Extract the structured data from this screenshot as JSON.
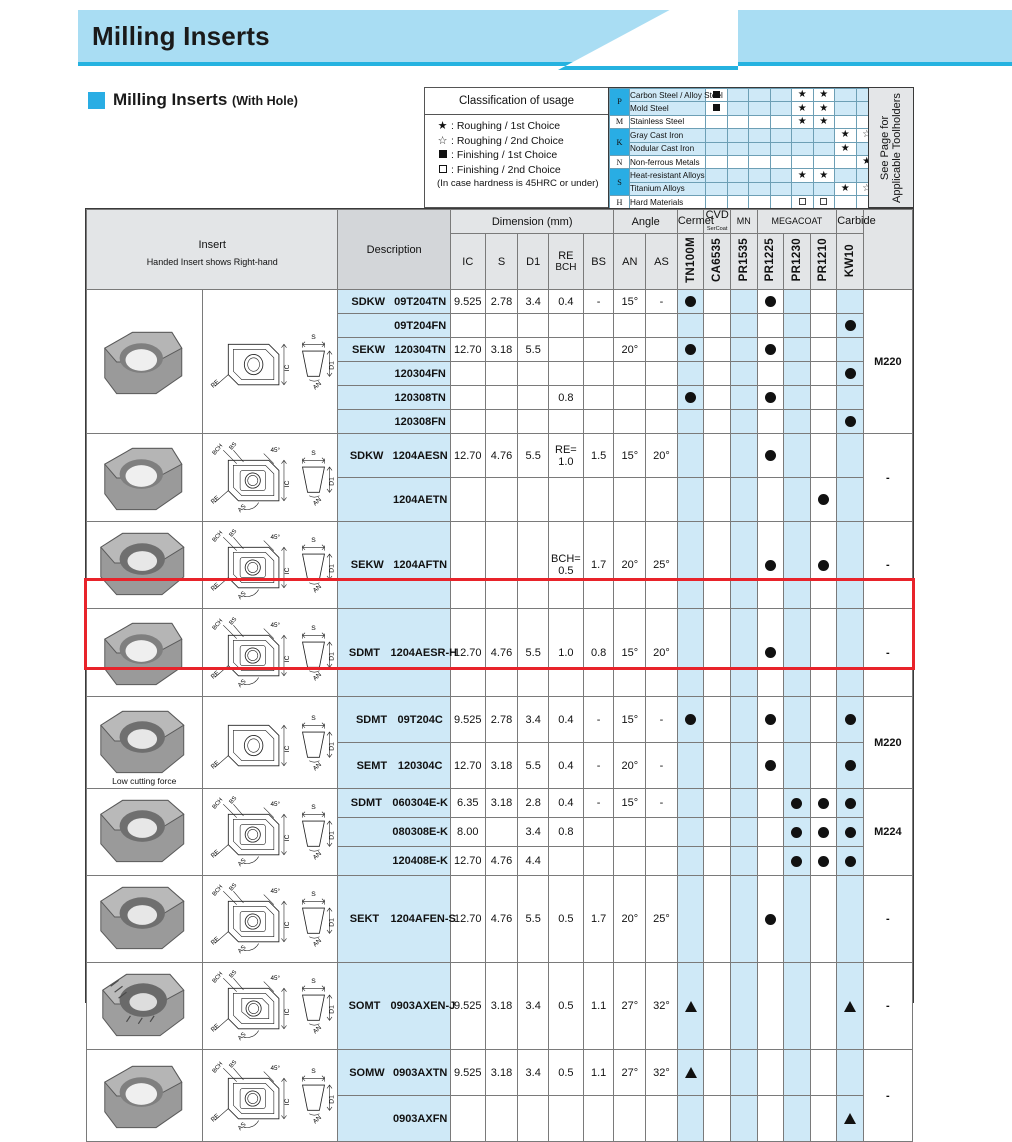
{
  "banner": {
    "title": "Milling Inserts"
  },
  "subtitle": {
    "text": "Milling Inserts",
    "suffix": "(With Hole)"
  },
  "legend": {
    "title": "Classification of usage",
    "rows": [
      {
        "symbol": "star-filled",
        "text": ": Roughing / 1st Choice"
      },
      {
        "symbol": "star-open",
        "text": ": Roughing / 2nd Choice"
      },
      {
        "symbol": "square-filled",
        "text": ": Finishing / 1st Choice"
      },
      {
        "symbol": "square-open",
        "text": ": Finishing / 2nd Choice"
      }
    ],
    "note": "(In case hardness is 45HRC or under)"
  },
  "matrix": {
    "rows": [
      {
        "cat": "P",
        "cat_span": 2,
        "cat_fill": "cyan",
        "name": "Carbon Steel / Alloy Steel",
        "name_fill": "lblue",
        "marks": [
          "square-filled",
          "",
          "",
          "",
          "star-filled",
          "star-filled",
          "",
          ""
        ]
      },
      {
        "cat": "",
        "cat_span": 0,
        "cat_fill": "cyan",
        "name": "Mold Steel",
        "name_fill": "lblue",
        "marks": [
          "square-filled",
          "",
          "",
          "",
          "star-filled",
          "star-filled",
          "",
          ""
        ]
      },
      {
        "cat": "M",
        "cat_span": 1,
        "cat_fill": "wh",
        "name": "Stainless Steel",
        "name_fill": "wh",
        "marks": [
          "",
          "",
          "",
          "",
          "star-filled",
          "star-filled",
          "",
          ""
        ]
      },
      {
        "cat": "K",
        "cat_span": 2,
        "cat_fill": "cyan",
        "name": "Gray Cast Iron",
        "name_fill": "lblue",
        "marks": [
          "",
          "",
          "",
          "",
          "",
          "",
          "star-filled",
          "star-open"
        ]
      },
      {
        "cat": "",
        "cat_span": 0,
        "cat_fill": "cyan",
        "name": "Nodular Cast Iron",
        "name_fill": "lblue",
        "marks": [
          "",
          "",
          "",
          "",
          "",
          "",
          "star-filled",
          ""
        ]
      },
      {
        "cat": "N",
        "cat_span": 1,
        "cat_fill": "wh",
        "name": "Non-ferrous Metals",
        "name_fill": "wh",
        "marks": [
          "",
          "",
          "",
          "",
          "",
          "",
          "",
          "star-filled"
        ]
      },
      {
        "cat": "S",
        "cat_span": 2,
        "cat_fill": "cyan",
        "name": "Heat-resistant Alloys",
        "name_fill": "lblue",
        "marks": [
          "",
          "",
          "",
          "",
          "star-filled",
          "star-filled",
          "",
          ""
        ]
      },
      {
        "cat": "",
        "cat_span": 0,
        "cat_fill": "cyan",
        "name": "Titanium Alloys",
        "name_fill": "lblue",
        "marks": [
          "",
          "",
          "",
          "",
          "",
          "",
          "star-filled",
          "star-open"
        ]
      },
      {
        "cat": "H",
        "cat_span": 1,
        "cat_fill": "wh",
        "name": "Hard Materials",
        "name_fill": "wh",
        "marks": [
          "",
          "",
          "",
          "",
          "square-open",
          "square-open",
          "",
          ""
        ]
      }
    ]
  },
  "side_column": {
    "line1": "See Page for",
    "line2": "Applicable Toolholders"
  },
  "table_header": {
    "insert": "Insert",
    "insert_note": "Handed Insert shows Right-hand",
    "description": "Description",
    "dimension": "Dimension (mm)",
    "angle": "Angle",
    "dim_cols": [
      "IC",
      "S",
      "D1",
      "RE\nBCH",
      "BS"
    ],
    "angle_cols": [
      "AN",
      "AS"
    ],
    "grade_groups": [
      "Cermet",
      "CVD\nSeriCoat",
      "MN",
      "MEGACOAT",
      "Carbide"
    ],
    "grade_names": [
      "TN100M",
      "CA6535",
      "PR1535",
      "PR1225",
      "PR1230",
      "PR1210",
      "KW10"
    ]
  },
  "blocks": [
    {
      "id": "block-1",
      "caption": "",
      "highlight": false,
      "toolholder": "M220",
      "rows": [
        {
          "prefix": "SDKW",
          "code": "09T204TN",
          "ic": "9.525",
          "s": "2.78",
          "d1": "3.4",
          "re": "0.4",
          "bs": "-",
          "an": "15°",
          "as": "-",
          "grades": [
            "dot",
            "",
            "",
            "dot",
            "",
            "",
            ""
          ]
        },
        {
          "prefix": "",
          "code": "09T204FN",
          "ic": "",
          "s": "",
          "d1": "",
          "re": "",
          "bs": "",
          "an": "",
          "as": "",
          "grades": [
            "",
            "",
            "",
            "",
            "",
            "",
            "dot"
          ]
        },
        {
          "prefix": "SEKW",
          "code": "120304TN",
          "ic": "12.70",
          "s": "3.18",
          "d1": "5.5",
          "re": "",
          "bs": "",
          "an": "20°",
          "as": "",
          "grades": [
            "dot",
            "",
            "",
            "dot",
            "",
            "",
            ""
          ]
        },
        {
          "prefix": "",
          "code": "120304FN",
          "ic": "",
          "s": "",
          "d1": "",
          "re": "",
          "bs": "",
          "an": "",
          "as": "",
          "grades": [
            "",
            "",
            "",
            "",
            "",
            "",
            "dot"
          ]
        },
        {
          "prefix": "",
          "code": "120308TN",
          "ic": "",
          "s": "",
          "d1": "",
          "re": "0.8",
          "bs": "",
          "an": "",
          "as": "",
          "grades": [
            "dot",
            "",
            "",
            "dot",
            "",
            "",
            ""
          ]
        },
        {
          "prefix": "",
          "code": "120308FN",
          "ic": "",
          "s": "",
          "d1": "",
          "re": "",
          "bs": "",
          "an": "",
          "as": "",
          "grades": [
            "",
            "",
            "",
            "",
            "",
            "",
            "dot"
          ]
        }
      ]
    },
    {
      "id": "block-2",
      "caption": "",
      "highlight": false,
      "toolholder": "-",
      "rows": [
        {
          "prefix": "SDKW",
          "code": "1204AESN",
          "ic": "12.70",
          "s": "4.76",
          "d1": "5.5",
          "re": "RE=\n1.0",
          "bs": "1.5",
          "an": "15°",
          "as": "20°",
          "grades": [
            "",
            "",
            "",
            "dot",
            "",
            "",
            ""
          ]
        },
        {
          "prefix": "",
          "code": "1204AETN",
          "ic": "",
          "s": "",
          "d1": "",
          "re": "",
          "bs": "",
          "an": "",
          "as": "",
          "grades": [
            "",
            "",
            "",
            "",
            "",
            "dot",
            ""
          ]
        }
      ]
    },
    {
      "id": "block-3",
      "caption": "",
      "highlight": false,
      "toolholder": "-",
      "rows": [
        {
          "prefix": "SEKW",
          "code": "1204AFTN",
          "ic": "",
          "s": "",
          "d1": "",
          "re": "BCH=\n0.5",
          "bs": "1.7",
          "an": "20°",
          "as": "25°",
          "grades": [
            "",
            "",
            "",
            "dot",
            "",
            "dot",
            ""
          ]
        }
      ]
    },
    {
      "id": "block-4",
      "caption": "",
      "highlight": false,
      "toolholder": "-",
      "rows": [
        {
          "prefix": "SDMT",
          "code": "1204AESR-H",
          "ic": "12.70",
          "s": "4.76",
          "d1": "5.5",
          "re": "1.0",
          "bs": "0.8",
          "an": "15°",
          "as": "20°",
          "grades": [
            "",
            "",
            "",
            "dot",
            "",
            "",
            ""
          ]
        }
      ]
    },
    {
      "id": "block-5",
      "caption": "Low cutting force",
      "highlight": true,
      "toolholder": "M220",
      "rows": [
        {
          "prefix": "SDMT",
          "code": "09T204C",
          "ic": "9.525",
          "s": "2.78",
          "d1": "3.4",
          "re": "0.4",
          "bs": "-",
          "an": "15°",
          "as": "-",
          "grades": [
            "dot",
            "",
            "",
            "dot",
            "",
            "",
            "dot"
          ]
        },
        {
          "prefix": "SEMT",
          "code": "120304C",
          "ic": "12.70",
          "s": "3.18",
          "d1": "5.5",
          "re": "0.4",
          "bs": "-",
          "an": "20°",
          "as": "-",
          "grades": [
            "",
            "",
            "",
            "dot",
            "",
            "",
            "dot"
          ]
        }
      ]
    },
    {
      "id": "block-6",
      "caption": "",
      "highlight": false,
      "toolholder": "M224",
      "rows": [
        {
          "prefix": "SDMT",
          "code": "060304E-K",
          "ic": "6.35",
          "s": "3.18",
          "d1": "2.8",
          "re": "0.4",
          "bs": "-",
          "an": "15°",
          "as": "-",
          "grades": [
            "",
            "",
            "",
            "",
            "dot",
            "dot",
            "dot"
          ]
        },
        {
          "prefix": "",
          "code": "080308E-K",
          "ic": "8.00",
          "s": "",
          "d1": "3.4",
          "re": "0.8",
          "bs": "",
          "an": "",
          "as": "",
          "grades": [
            "",
            "",
            "",
            "",
            "dot",
            "dot",
            "dot"
          ]
        },
        {
          "prefix": "",
          "code": "120408E-K",
          "ic": "12.70",
          "s": "4.76",
          "d1": "4.4",
          "re": "",
          "bs": "",
          "an": "",
          "as": "",
          "grades": [
            "",
            "",
            "",
            "",
            "dot",
            "dot",
            "dot"
          ]
        }
      ]
    },
    {
      "id": "block-7",
      "caption": "",
      "highlight": false,
      "toolholder": "-",
      "rows": [
        {
          "prefix": "SEKT",
          "code": "1204AFEN-S",
          "ic": "12.70",
          "s": "4.76",
          "d1": "5.5",
          "re": "0.5",
          "bs": "1.7",
          "an": "20°",
          "as": "25°",
          "grades": [
            "",
            "",
            "",
            "dot",
            "",
            "",
            ""
          ]
        }
      ]
    },
    {
      "id": "block-8",
      "caption": "",
      "highlight": false,
      "toolholder": "-",
      "rows": [
        {
          "prefix": "SOMT",
          "code": "0903AXEN-J",
          "ic": "9.525",
          "s": "3.18",
          "d1": "3.4",
          "re": "0.5",
          "bs": "1.1",
          "an": "27°",
          "as": "32°",
          "grades": [
            "tri",
            "",
            "",
            "",
            "",
            "",
            "tri"
          ]
        }
      ]
    },
    {
      "id": "block-9",
      "caption": "",
      "highlight": false,
      "toolholder": "-",
      "rows": [
        {
          "prefix": "SOMW",
          "code": "0903AXTN",
          "ic": "9.525",
          "s": "3.18",
          "d1": "3.4",
          "re": "0.5",
          "bs": "1.1",
          "an": "27°",
          "as": "32°",
          "grades": [
            "tri",
            "",
            "",
            "",
            "",
            "",
            ""
          ]
        },
        {
          "prefix": "",
          "code": "0903AXFN",
          "ic": "",
          "s": "",
          "d1": "",
          "re": "",
          "bs": "",
          "an": "",
          "as": "",
          "grades": [
            "",
            "",
            "",
            "",
            "",
            "",
            "tri"
          ]
        }
      ]
    }
  ],
  "drawing_labels": {
    "s": "S",
    "ic": "IC",
    "d1": "D1",
    "re": "RE",
    "an": "AN",
    "as": "AS",
    "bch": "BCH",
    "bs": "BS",
    "deg45": "45°"
  },
  "colors": {
    "banner": "#a9ddf3",
    "accent": "#29ade4",
    "highlight": "#e8232a",
    "row_blue": "#cfe9f7"
  }
}
